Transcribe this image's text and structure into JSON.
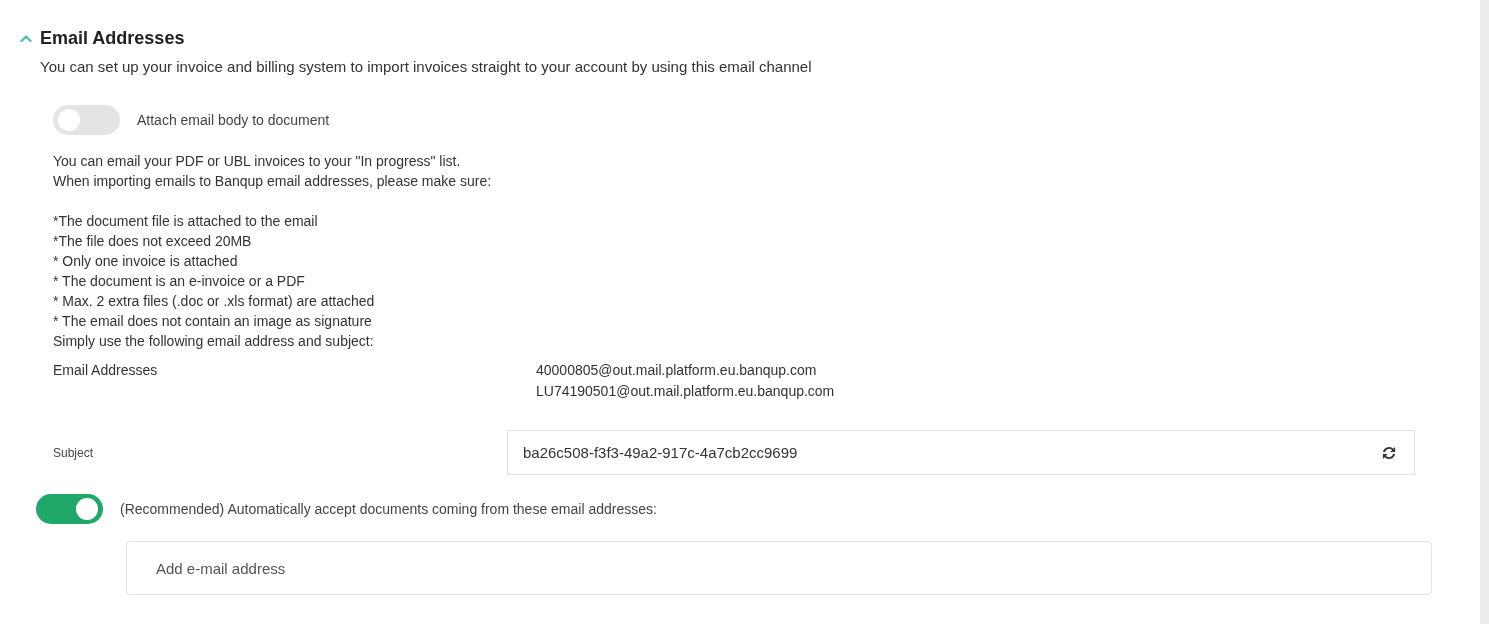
{
  "section": {
    "title": "Email Addresses",
    "expanded": true,
    "description": "You can set up your invoice and billing system to import invoices straight to your account by using this email channel"
  },
  "attach_toggle": {
    "label": "Attach email body to document",
    "on": false
  },
  "intro_lines": [
    "You can email your PDF or UBL invoices to your \"In progress\" list.",
    "When importing emails to Banqup email addresses, please make sure:"
  ],
  "requirements": [
    "*The document file is attached to the email",
    "*The file does not exceed 20MB",
    "* Only one invoice is attached",
    "* The document is an e-invoice or a PDF",
    "* Max. 2 extra files (.doc or .xls format) are attached",
    "* The email does not contain an image as signature"
  ],
  "closing": "Simply use the following email address and subject:",
  "addresses": {
    "label": "Email Addresses",
    "values": [
      "40000805@out.mail.platform.eu.banqup.com",
      "LU74190501@out.mail.platform.eu.banqup.com"
    ]
  },
  "subject": {
    "label": "Subject",
    "value": "ba26c508-f3f3-49a2-917c-4a7cb2cc9699"
  },
  "auto_accept": {
    "label": "(Recommended) Automatically accept documents coming from these email addresses:",
    "on": true
  },
  "add_email": {
    "placeholder": "Add e-mail address"
  }
}
